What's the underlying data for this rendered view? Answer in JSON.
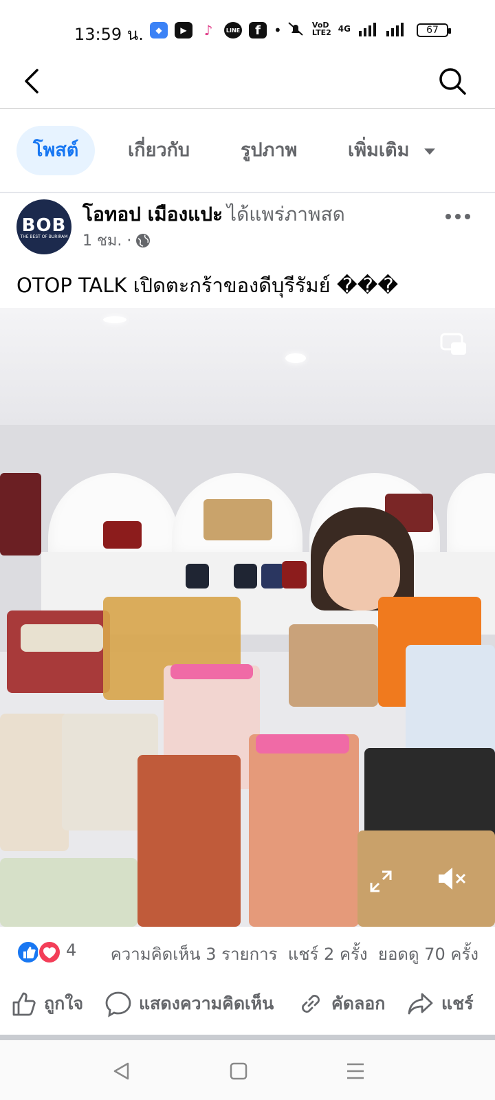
{
  "status_bar": {
    "time": "13:59 น.",
    "battery": "67",
    "network": "4G"
  },
  "tabs": [
    {
      "label": "โพสต์",
      "active": true
    },
    {
      "label": "เกี่ยวกับ",
      "active": false
    },
    {
      "label": "รูปภาพ",
      "active": false
    },
    {
      "label": "เพิ่มเติม",
      "active": false
    }
  ],
  "post": {
    "author": "โอทอป เมืองแปะ",
    "action": "ได้แพร่ภาพสด",
    "time": "1 ชม. ·",
    "privacy_icon": "globe-icon",
    "avatar_logo": "BOB",
    "avatar_tagline": "THE BEST OF BURIRAM",
    "caption": "OTOP TALK เปิดตะกร้าของดีบุรีรัมย์ ���"
  },
  "reactions": {
    "count": "4",
    "icons": [
      "like-icon",
      "love-icon"
    ],
    "comments": "ความคิดเห็น 3 รายการ",
    "shares": "แชร์ 2 ครั้ง",
    "views": "ยอดดู 70 ครั้ง"
  },
  "actions": {
    "like": "ถูกใจ",
    "comment": "แสดงความคิดเห็น",
    "copy": "คัดลอก",
    "share": "แชร์"
  },
  "colors": {
    "accent": "#1877f2",
    "secondary_text": "#65676b",
    "active_tab_bg": "#e7f3ff",
    "like_blue": "#1877f2",
    "love_red": "#f33e58"
  }
}
